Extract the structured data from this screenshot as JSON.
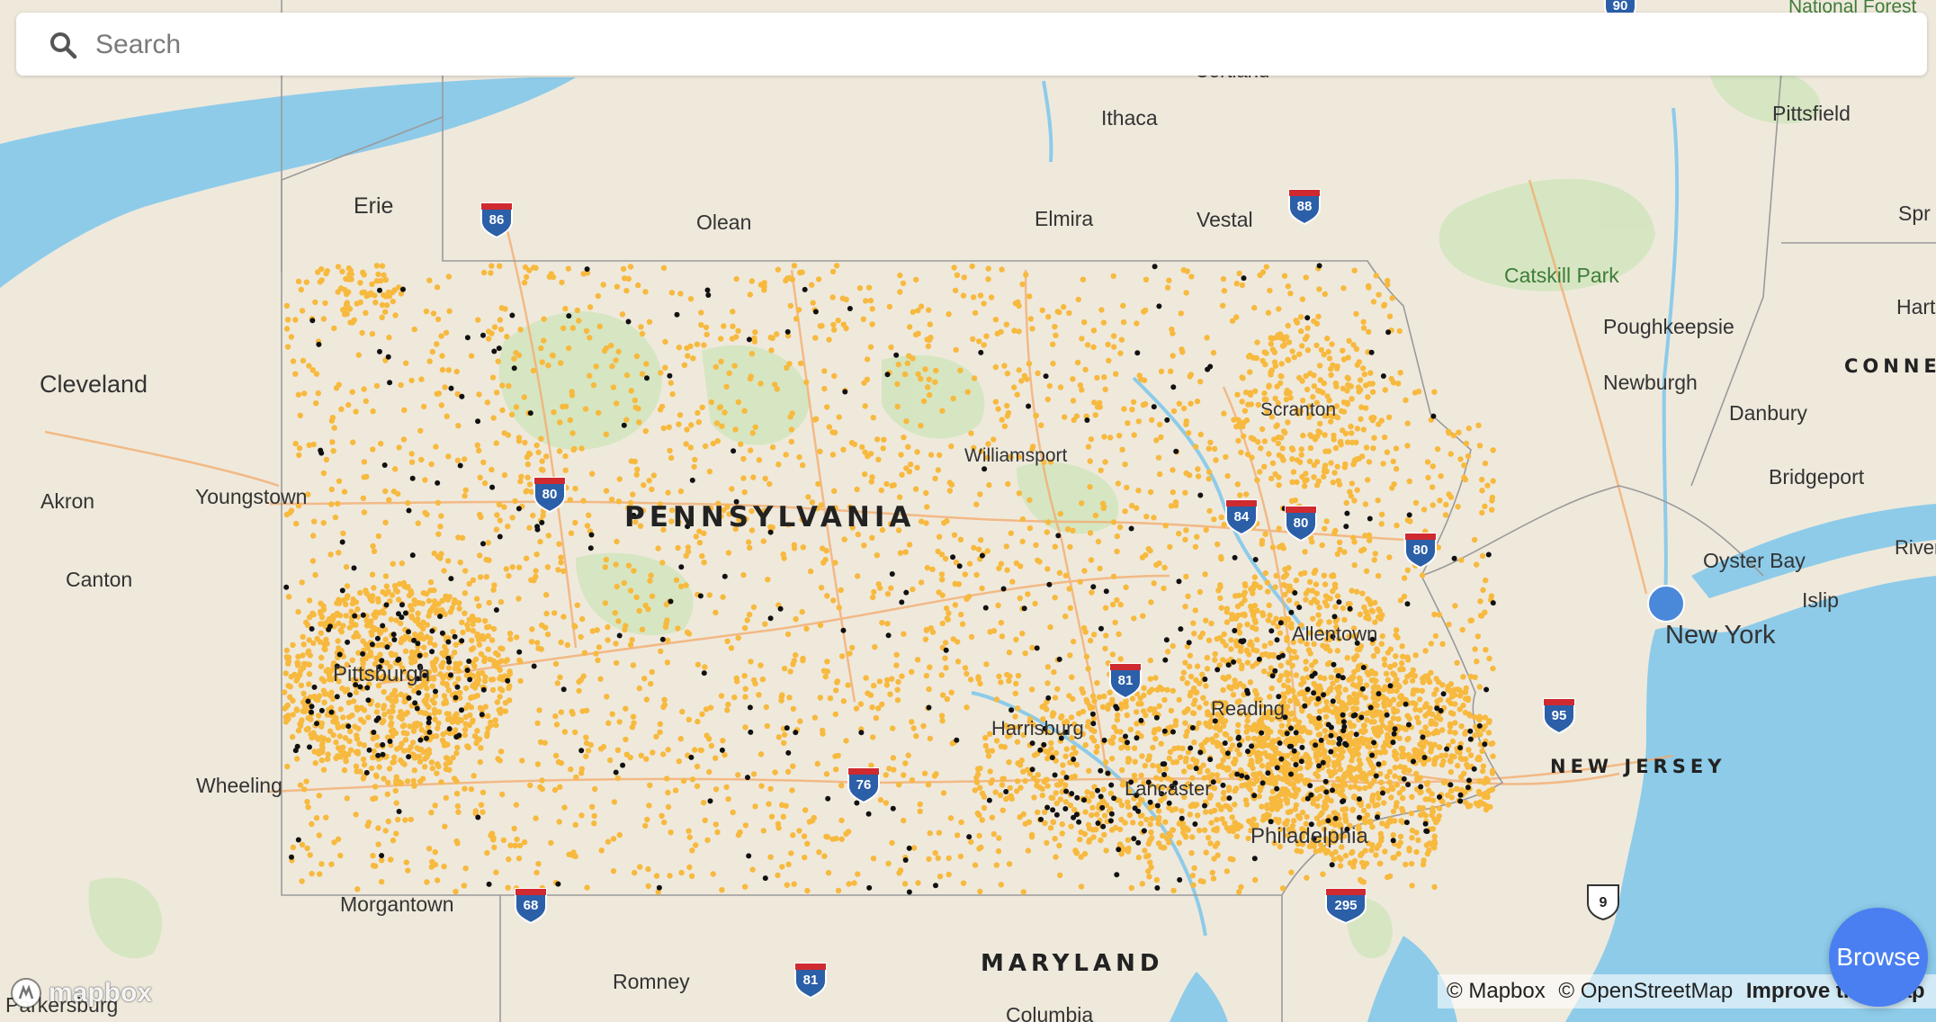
{
  "search": {
    "placeholder": "Search"
  },
  "browse_button": {
    "label": "Browse"
  },
  "attribution": {
    "mapbox": "© Mapbox",
    "osm": "© OpenStreetMap",
    "improve": "Improve this map"
  },
  "logo": {
    "text": "mapbox"
  },
  "colors": {
    "land": "#efe9dc",
    "water": "#8dcbe9",
    "forest": "#d1e4bd",
    "point_orange": "#f7b93e",
    "point_black": "#111111",
    "user_location": "#4a88d9",
    "browse_button": "#4a7ff2",
    "interstate_blue": "#2b5fa8",
    "interstate_red": "#cf2a30"
  },
  "map": {
    "state_labels": [
      {
        "name": "PENNSYLVANIA"
      },
      {
        "name": "MARYLAND"
      },
      {
        "name": "NEW JERSEY"
      },
      {
        "name": "CONNEC"
      }
    ],
    "place_labels": [
      {
        "name": "Erie"
      },
      {
        "name": "Olean"
      },
      {
        "name": "Elmira"
      },
      {
        "name": "Vestal"
      },
      {
        "name": "Ithaca"
      },
      {
        "name": "Cortland"
      },
      {
        "name": "Pittsfield"
      },
      {
        "name": "Catskill Park"
      },
      {
        "name": "Poughkeepsie"
      },
      {
        "name": "Newburgh"
      },
      {
        "name": "Danbury"
      },
      {
        "name": "Bridgeport"
      },
      {
        "name": "Oyster Bay"
      },
      {
        "name": "Islip"
      },
      {
        "name": "New York"
      },
      {
        "name": "Hart"
      },
      {
        "name": "Spr"
      },
      {
        "name": "River"
      },
      {
        "name": "National Forest"
      },
      {
        "name": "Cleveland"
      },
      {
        "name": "Akron"
      },
      {
        "name": "Canton"
      },
      {
        "name": "Youngstown"
      },
      {
        "name": "Wheeling"
      },
      {
        "name": "Morgantown"
      },
      {
        "name": "Romney"
      },
      {
        "name": "Parkersburg"
      },
      {
        "name": "Columbia"
      },
      {
        "name": "Williamsport"
      },
      {
        "name": "Scranton"
      },
      {
        "name": "Harrisburg"
      },
      {
        "name": "Reading"
      },
      {
        "name": "Allentown"
      },
      {
        "name": "Lancaster"
      },
      {
        "name": "Philadelphia"
      },
      {
        "name": "Pittsburgh"
      }
    ],
    "highway_shields": [
      {
        "number": "86",
        "type": "interstate"
      },
      {
        "number": "88",
        "type": "interstate"
      },
      {
        "number": "80",
        "type": "interstate"
      },
      {
        "number": "84",
        "type": "interstate"
      },
      {
        "number": "80",
        "type": "interstate"
      },
      {
        "number": "80",
        "type": "interstate"
      },
      {
        "number": "81",
        "type": "interstate"
      },
      {
        "number": "76",
        "type": "interstate"
      },
      {
        "number": "95",
        "type": "interstate"
      },
      {
        "number": "295",
        "type": "interstate"
      },
      {
        "number": "68",
        "type": "interstate"
      },
      {
        "number": "81",
        "type": "interstate"
      },
      {
        "number": "9",
        "type": "us-route"
      },
      {
        "number": "90",
        "type": "interstate"
      }
    ]
  }
}
